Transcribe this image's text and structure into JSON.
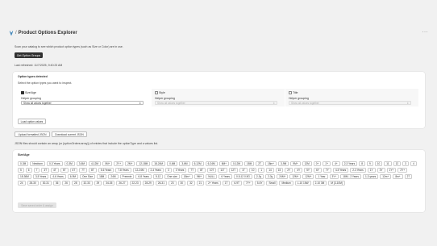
{
  "app": {
    "title": "Product Options Explorer",
    "more_label": "···"
  },
  "intro_text": "Scan your catalog to see which product option types (such as Size or Color) are in use.",
  "get_option_groups_label": "Get Option Groups",
  "last_refreshed": "Last refreshed: 11/7/2025, 9:40:23 AM",
  "option_types": {
    "title": "Option types detected",
    "subtitle": "Select the option types you want to inspect.",
    "columns": [
      {
        "name": "Size/Age",
        "checked": true,
        "helper": "Helper grouping",
        "select_value": "Show all values together",
        "disabled": false
      },
      {
        "name": "Style",
        "checked": false,
        "helper": "Helper grouping",
        "select_value": "Show all values together",
        "disabled": true
      },
      {
        "name": "Title",
        "checked": false,
        "helper": "Helper grouping",
        "select_value": "Show all values together",
        "disabled": true
      }
    ],
    "load_label": "Load option values"
  },
  "upload_label": "Upload formatted JSON",
  "download_label": "Download current JSON",
  "json_note": "JSON files should contain an array (or {optionOrders:array}) of entries that include the optionType and a values list.",
  "values_card": {
    "title": "Size/Age",
    "chips": [
      "0-3M",
      "Newborn",
      "0-3 Years",
      "0-3M",
      "3-6M",
      "4-12M",
      "0M+",
      "2Y+",
      "2M+",
      "12-18M",
      "18-24M",
      "0-6M",
      "3-6M",
      "6-12M",
      "6-24M",
      "6M+",
      "0-12M",
      "18M",
      "2T",
      "18m+",
      "3-9M",
      "9M+",
      "12M",
      "0+",
      "2+",
      "4+",
      "2-3 Years",
      "8",
      "9",
      "10",
      "11",
      "12",
      "3",
      "4",
      "5",
      "6",
      "7",
      "3T",
      "4T",
      "5T",
      "6T",
      "7T",
      "8T",
      "5-6 Years",
      "7-8 Years",
      "12-24M",
      "2-4 Years",
      "3",
      "3 Years",
      "7T",
      "8T",
      "10T",
      "11T",
      "12T",
      "1T",
      "10",
      "1",
      "14",
      "15",
      "2Y",
      "4Y",
      "5Y",
      "6Y",
      "7Y",
      "4-5 Years",
      "2-3 Years",
      "1Y",
      "3Y",
      "1Y+",
      "2Y+",
      "18-36M",
      "3-5 Years",
      "4-6 Years",
      "6-9M",
      "One Size",
      "18M",
      "24M",
      "Preemie",
      "6-8 Years",
      "9-12",
      "One size",
      "18m+",
      "9M+",
      "NULL",
      "6 Years",
      "0.5-12 0.5G",
      "2-3y",
      "2-3y",
      "24M+",
      "12M+",
      "12M+",
      "1 Year",
      "3Y+",
      "18M - 2 Years",
      "1-3 years",
      "12m+",
      "8m+",
      "27",
      "24",
      "28-30",
      "30-31",
      "36",
      "26",
      "28",
      "32-33",
      "29",
      "34-35",
      "26-27",
      "22-23",
      "28-29",
      "26-31",
      "23",
      "30",
      "32",
      "21",
      "2+ Years",
      "1T",
      "6-9T",
      "7Y+",
      "5-6Y",
      "Small",
      "Medium",
      "L-10 16W",
      "2-10 3M",
      "M (3-10M)"
    ]
  },
  "save_label": "Save saved order & assign"
}
